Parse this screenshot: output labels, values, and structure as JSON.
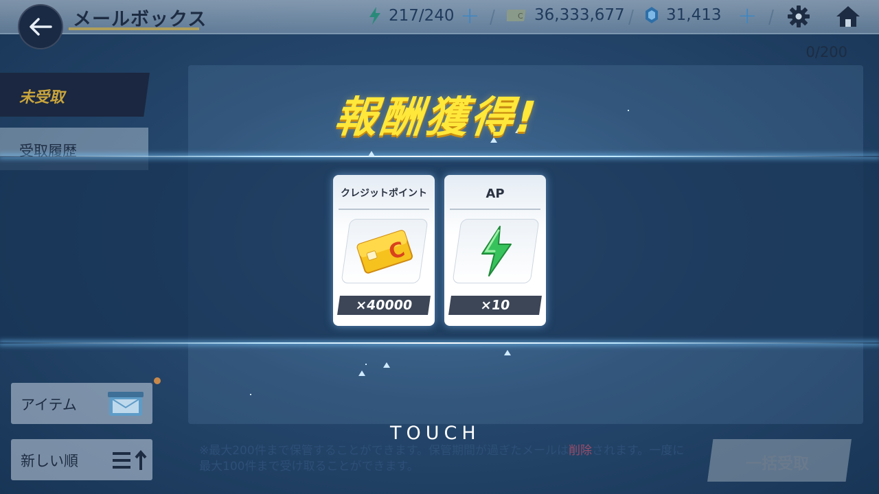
{
  "header": {
    "title": "メールボックス",
    "ap": "217/240",
    "credits": "36,333,677",
    "gems": "31,413"
  },
  "mailbox": {
    "capacity": "0/200",
    "tabs": [
      {
        "label": "未受取"
      },
      {
        "label": "受取履歴"
      }
    ],
    "filter_label": "アイテム",
    "sort_label": "新しい順",
    "note_before": "※最大200件まで保管することができます。保管期間が過ぎたメールは",
    "note_highlight": "削除",
    "note_after": "されます。一度に最大100件まで受け取ることができます。",
    "bulk_receive": "一括受取"
  },
  "reward": {
    "headline": "報酬獲得!",
    "items": [
      {
        "name": "クレジットポイント",
        "icon": "credit-card-icon",
        "quantity": "×40000"
      },
      {
        "name": "AP",
        "icon": "lightning-icon",
        "quantity": "×10"
      }
    ],
    "touch_prompt": "TOUCH"
  },
  "colors": {
    "headline": "#ffe83a",
    "accent_gold": "#c9a53c",
    "ap_green": "#2fbf5a"
  }
}
